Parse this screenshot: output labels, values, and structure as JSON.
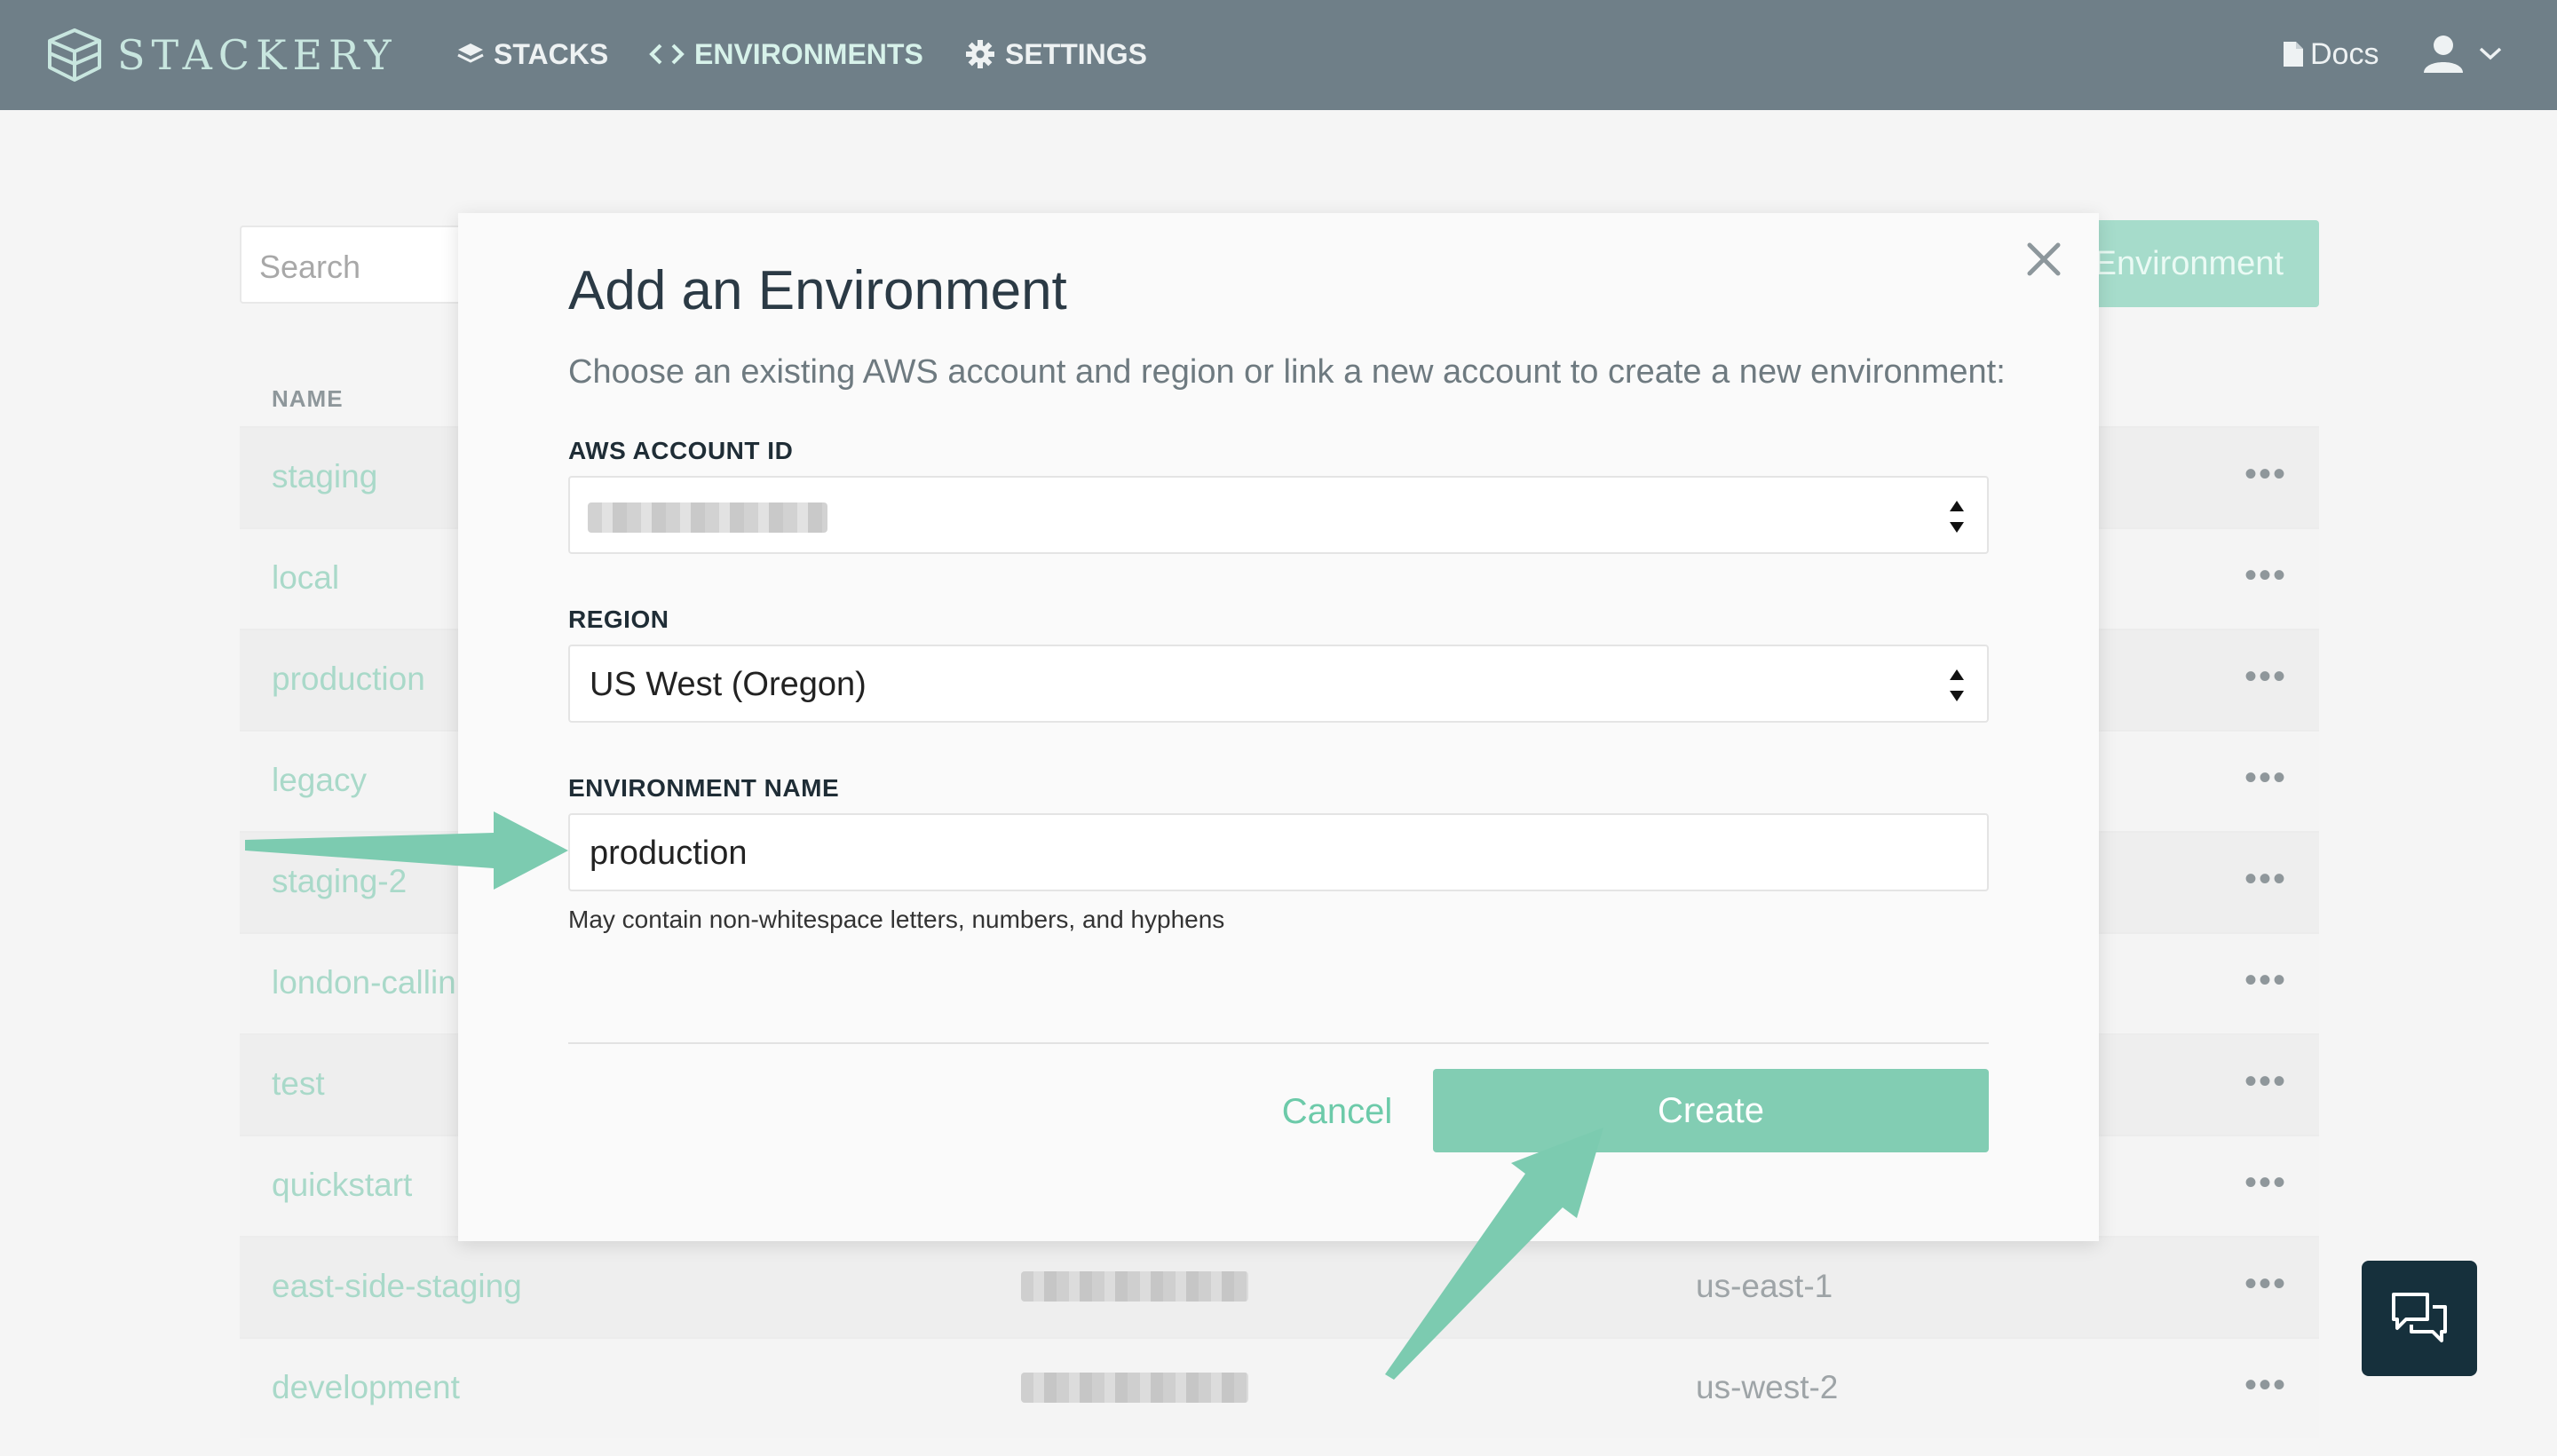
{
  "brand": {
    "name": "STACKERY"
  },
  "nav": {
    "stacks": "STACKS",
    "environments": "ENVIRONMENTS",
    "settings": "SETTINGS",
    "docs": "Docs"
  },
  "page": {
    "search_placeholder": "Search",
    "add_button": "Environment",
    "column_name": "NAME",
    "rows": [
      {
        "name": "staging",
        "region": ""
      },
      {
        "name": "local",
        "region": ""
      },
      {
        "name": "production",
        "region": ""
      },
      {
        "name": "legacy",
        "region": ""
      },
      {
        "name": "staging-2",
        "region": ""
      },
      {
        "name": "london-callin",
        "region": ""
      },
      {
        "name": "test",
        "region": ""
      },
      {
        "name": "quickstart",
        "region": ""
      },
      {
        "name": "east-side-staging",
        "region": "us-east-1"
      },
      {
        "name": "development",
        "region": "us-west-2"
      }
    ],
    "row_menu": "•••"
  },
  "modal": {
    "title": "Add an Environment",
    "description": "Choose an existing AWS account and region or link a new account to create a new environment:",
    "account_label": "AWS ACCOUNT ID",
    "region_label": "REGION",
    "region_value": "US West (Oregon)",
    "name_label": "ENVIRONMENT NAME",
    "name_value": "production",
    "name_hint": "May contain non-whitespace letters, numbers, and hyphens",
    "cancel": "Cancel",
    "create": "Create"
  },
  "colors": {
    "nav_bg": "#6f7f88",
    "accent": "#82cdb3",
    "annotation_arrow": "#7ccbb0",
    "chat_bg": "#16303c"
  }
}
